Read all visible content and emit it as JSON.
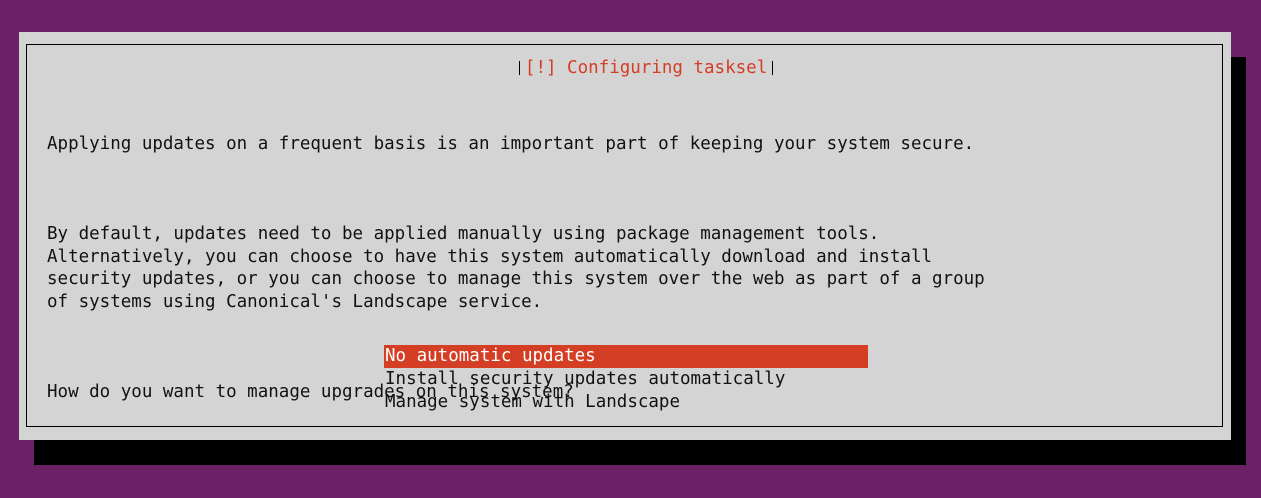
{
  "dialog": {
    "title": "[!] Configuring tasksel",
    "paragraphs": [
      "Applying updates on a frequent basis is an important part of keeping your system secure.",
      "By default, updates need to be applied manually using package management tools.\nAlternatively, you can choose to have this system automatically download and install\nsecurity updates, or you can choose to manage this system over the web as part of a group\nof systems using Canonical's Landscape service."
    ],
    "question": "How do you want to manage upgrades on this system?",
    "options": [
      {
        "label": "No automatic updates",
        "selected": true
      },
      {
        "label": "Install security updates automatically",
        "selected": false
      },
      {
        "label": "Manage system with Landscape",
        "selected": false
      }
    ]
  },
  "colors": {
    "background": "#6c2166",
    "dialog": "#d4d4d4",
    "accent": "#d43e24",
    "shadow": "#000000"
  }
}
